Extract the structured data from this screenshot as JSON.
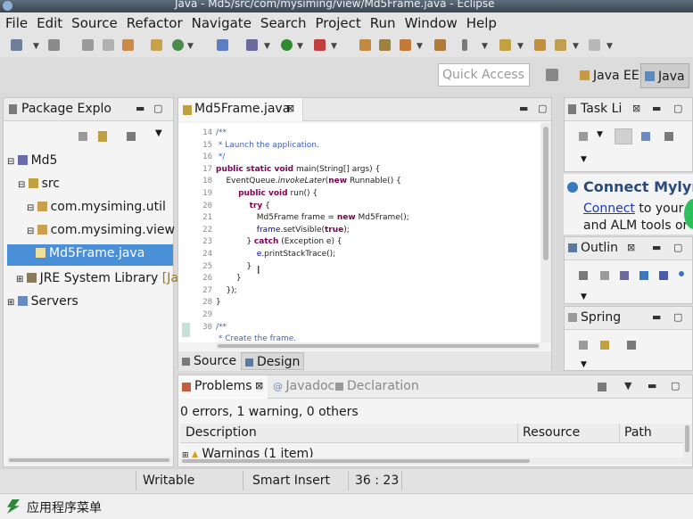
{
  "window": {
    "title": "Java - Md5/src/com/mysiming/view/Md5Frame.java - Eclipse"
  },
  "menu": [
    "File",
    "Edit",
    "Source",
    "Refactor",
    "Navigate",
    "Search",
    "Project",
    "Run",
    "Window",
    "Help"
  ],
  "quick_access": {
    "placeholder": "Quick Access"
  },
  "perspectives": {
    "java_ee": "Java EE",
    "java": "Java"
  },
  "package_explorer": {
    "title": "Package Explo",
    "tree": [
      "Md5",
      "src",
      "com.mysiming.util",
      "com.mysiming.view",
      "Md5Frame.java",
      "JRE System Library",
      "[Jav",
      "Servers"
    ]
  },
  "editor": {
    "tab": "Md5Frame.java",
    "lines": [
      {
        "n": "14",
        "text": "/**"
      },
      {
        "n": "15",
        "text": " * Launch the application."
      },
      {
        "n": "16",
        "text": " */"
      },
      {
        "n": "17",
        "kw": "public static void",
        "text": " main(String[] args) {"
      },
      {
        "n": "18",
        "text": "    EventQueue.",
        "ital": "invokeLater",
        "post": "(",
        "kw2": "new",
        "post2": " Runnable() {"
      },
      {
        "n": "19",
        "kw": "        public void",
        "text": " run() {"
      },
      {
        "n": "20",
        "kw": "            try",
        "text": " {"
      },
      {
        "n": "21",
        "text": "                Md5Frame frame = ",
        "kw2": "new",
        "post2": " Md5Frame();"
      },
      {
        "n": "22",
        "fld": "                frame",
        "text": ".setVisible(",
        "kw2": "true",
        "post2": ");"
      },
      {
        "n": "23",
        "text": "            } ",
        "kw2": "catch",
        "post2": " (Exception e) {"
      },
      {
        "n": "24",
        "fld": "                e",
        "text": ".printStackTrace();"
      },
      {
        "n": "25",
        "text": "            }"
      },
      {
        "n": "26",
        "text": "        }"
      },
      {
        "n": "27",
        "text": "    });"
      },
      {
        "n": "28",
        "text": "}"
      },
      {
        "n": "29",
        "text": ""
      },
      {
        "n": "30",
        "text": "/**"
      },
      {
        "n": "",
        "text": " * Create the frame."
      }
    ],
    "bottom_tabs": {
      "source": "Source",
      "design": "Design"
    }
  },
  "task_list": {
    "title": "Task Li"
  },
  "mylyn": {
    "title": "Connect Mylyn",
    "link": "Connect",
    "text1": " to your ta",
    "text2": "and ALM tools or"
  },
  "outline": {
    "title": "Outlin"
  },
  "spring": {
    "title": "Spring"
  },
  "problems": {
    "tab": "Problems",
    "other_tabs": [
      "Javadoc",
      "Declaration"
    ],
    "summary": "0 errors, 1 warning, 0 others",
    "columns": [
      "Description",
      "Resource",
      "Path"
    ],
    "rows": [
      "Warnings (1 item)"
    ]
  },
  "status": {
    "writable": "Writable",
    "insert_mode": "Smart Insert",
    "position": "36 : 23"
  },
  "taskbar": {
    "menu_label": "应用程序菜单"
  },
  "colors": {
    "accent_selection": "#4a90d9",
    "keyword": "#7f0055",
    "comment": "#3f5fbf"
  }
}
